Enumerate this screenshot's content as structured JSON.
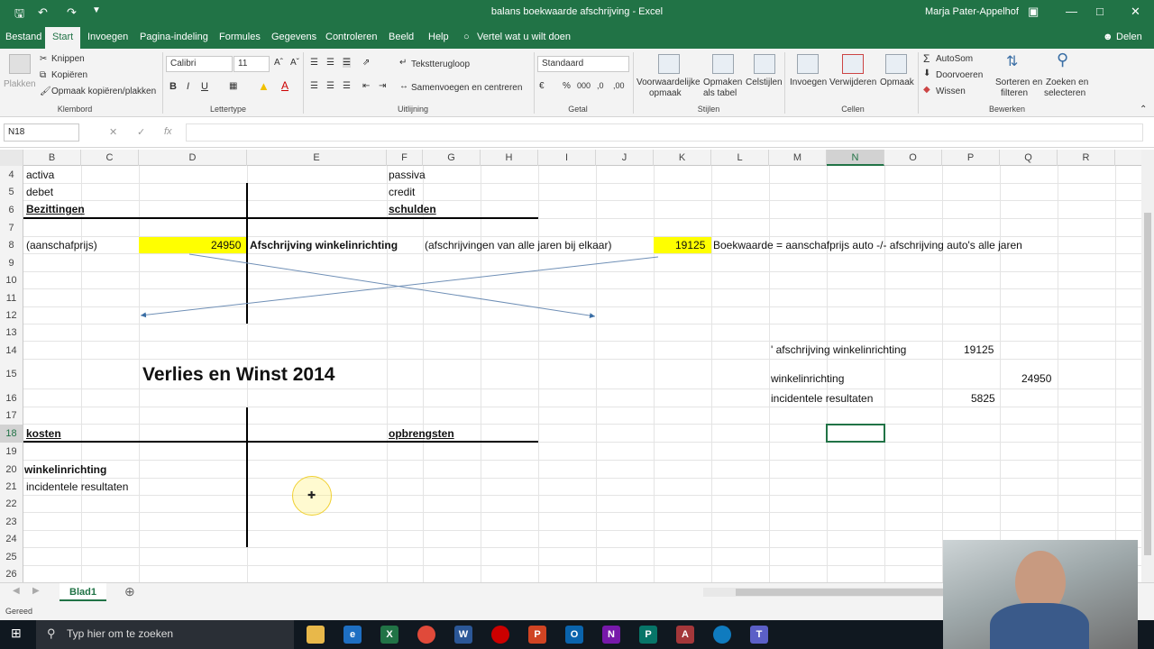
{
  "titlebar": {
    "doc_title": "balans boekwaarde afschrijving - Excel",
    "user": "Marja Pater-Appelhof"
  },
  "tabs": [
    "Bestand",
    "Start",
    "Invoegen",
    "Pagina-indeling",
    "Formules",
    "Gegevens",
    "Controleren",
    "Beeld",
    "Help"
  ],
  "tell_me": "Vertel wat u wilt doen",
  "share": "Delen",
  "ribbon": {
    "plakken": "Plakken",
    "knippen": "Knippen",
    "kopieren": "Kopiëren",
    "opmaak_kopieren": "Opmaak kopiëren/plakken",
    "grp_klembord": "Klembord",
    "font_name": "Calibri",
    "font_size": "11",
    "grp_lettertype": "Lettertype",
    "tekstterugloop": "Tekstterugloop",
    "samenvoegen": "Samenvoegen en centreren",
    "grp_uitlijning": "Uitlijning",
    "number_format": "Standaard",
    "grp_getal": "Getal",
    "voorwaardelijke": "Voorwaardelijke",
    "voorwaardelijke2": "opmaak",
    "opmaken_tabel": "Opmaken",
    "opmaken_tabel2": "als tabel",
    "celstijlen": "Celstijlen",
    "grp_stijlen": "Stijlen",
    "invoegen": "Invoegen",
    "verwijderen": "Verwijderen",
    "opmaak": "Opmaak",
    "grp_cellen": "Cellen",
    "autosom": "AutoSom",
    "doorvoeren": "Doorvoeren",
    "wissen": "Wissen",
    "sorteren": "Sorteren en",
    "sorteren2": "filteren",
    "zoeken": "Zoeken en",
    "zoeken2": "selecteren",
    "grp_bewerken": "Bewerken"
  },
  "namebox": "N18",
  "columns": [
    "B",
    "C",
    "D",
    "E",
    "F",
    "G",
    "H",
    "I",
    "J",
    "K",
    "L",
    "M",
    "N",
    "O",
    "P",
    "Q",
    "R"
  ],
  "rows": [
    "4",
    "5",
    "6",
    "7",
    "8",
    "9",
    "10",
    "11",
    "12",
    "13",
    "14",
    "15",
    "16",
    "17",
    "18",
    "19",
    "20",
    "21",
    "22",
    "23",
    "24",
    "25",
    "26"
  ],
  "cells": {
    "activa": "activa",
    "passiva": "passiva",
    "debet": "debet",
    "credit": "credit",
    "bezittingen": "Bezittingen",
    "schulden": "schulden",
    "aanschafprijs": "(aanschafprijs)",
    "d8": "24950",
    "afschrijving": "Afschrijving winkelinrichting",
    "alle_jaren": "(afschrijvingen van alle jaren bij elkaar)",
    "k8": "19125",
    "boekwaarde": "Boekwaarde = aanschafprijs auto -/- afschrijving auto's alle jaren",
    "m14": "' afschrijving winkelinrichting",
    "p14": "19125",
    "vw_title": "Verlies en Winst 2014",
    "m15": "winkelinrichting",
    "q15": "24950",
    "m16": "incidentele resultaten",
    "p16": "5825",
    "kosten": "kosten",
    "opbrengsten": "opbrengsten",
    "b20": "winkelinrichting",
    "b21": "incidentele resultaten"
  },
  "sheet_tab": "Blad1",
  "status": "Gereed",
  "taskbar_search": "Typ hier om te zoeken"
}
